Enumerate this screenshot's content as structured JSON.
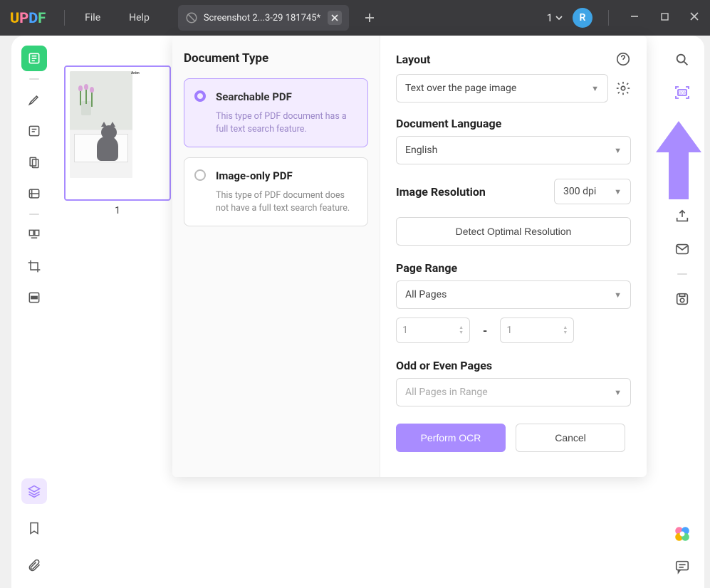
{
  "titlebar": {
    "menu_file": "File",
    "menu_help": "Help",
    "tab_title": "Screenshot 2...3-29 181745*",
    "tab_count": "1",
    "avatar_letter": "R"
  },
  "thumbnail": {
    "page_number": "1",
    "heading": "Anim"
  },
  "panel": {
    "left_heading": "Document Type",
    "searchable": {
      "title": "Searchable PDF",
      "desc": "This type of PDF document has a full text search feature."
    },
    "imageonly": {
      "title": "Image-only PDF",
      "desc": "This type of PDF document does not have a full text search feature."
    },
    "layout_label": "Layout",
    "layout_value": "Text over the page image",
    "lang_label": "Document Language",
    "lang_value": "English",
    "res_label": "Image Resolution",
    "res_value": "300 dpi",
    "detect_btn": "Detect Optimal Resolution",
    "range_label": "Page Range",
    "range_value": "All Pages",
    "range_from": "1",
    "range_to": "1",
    "odd_label": "Odd or Even Pages",
    "odd_value": "All Pages in Range",
    "perform_btn": "Perform OCR",
    "cancel_btn": "Cancel"
  }
}
